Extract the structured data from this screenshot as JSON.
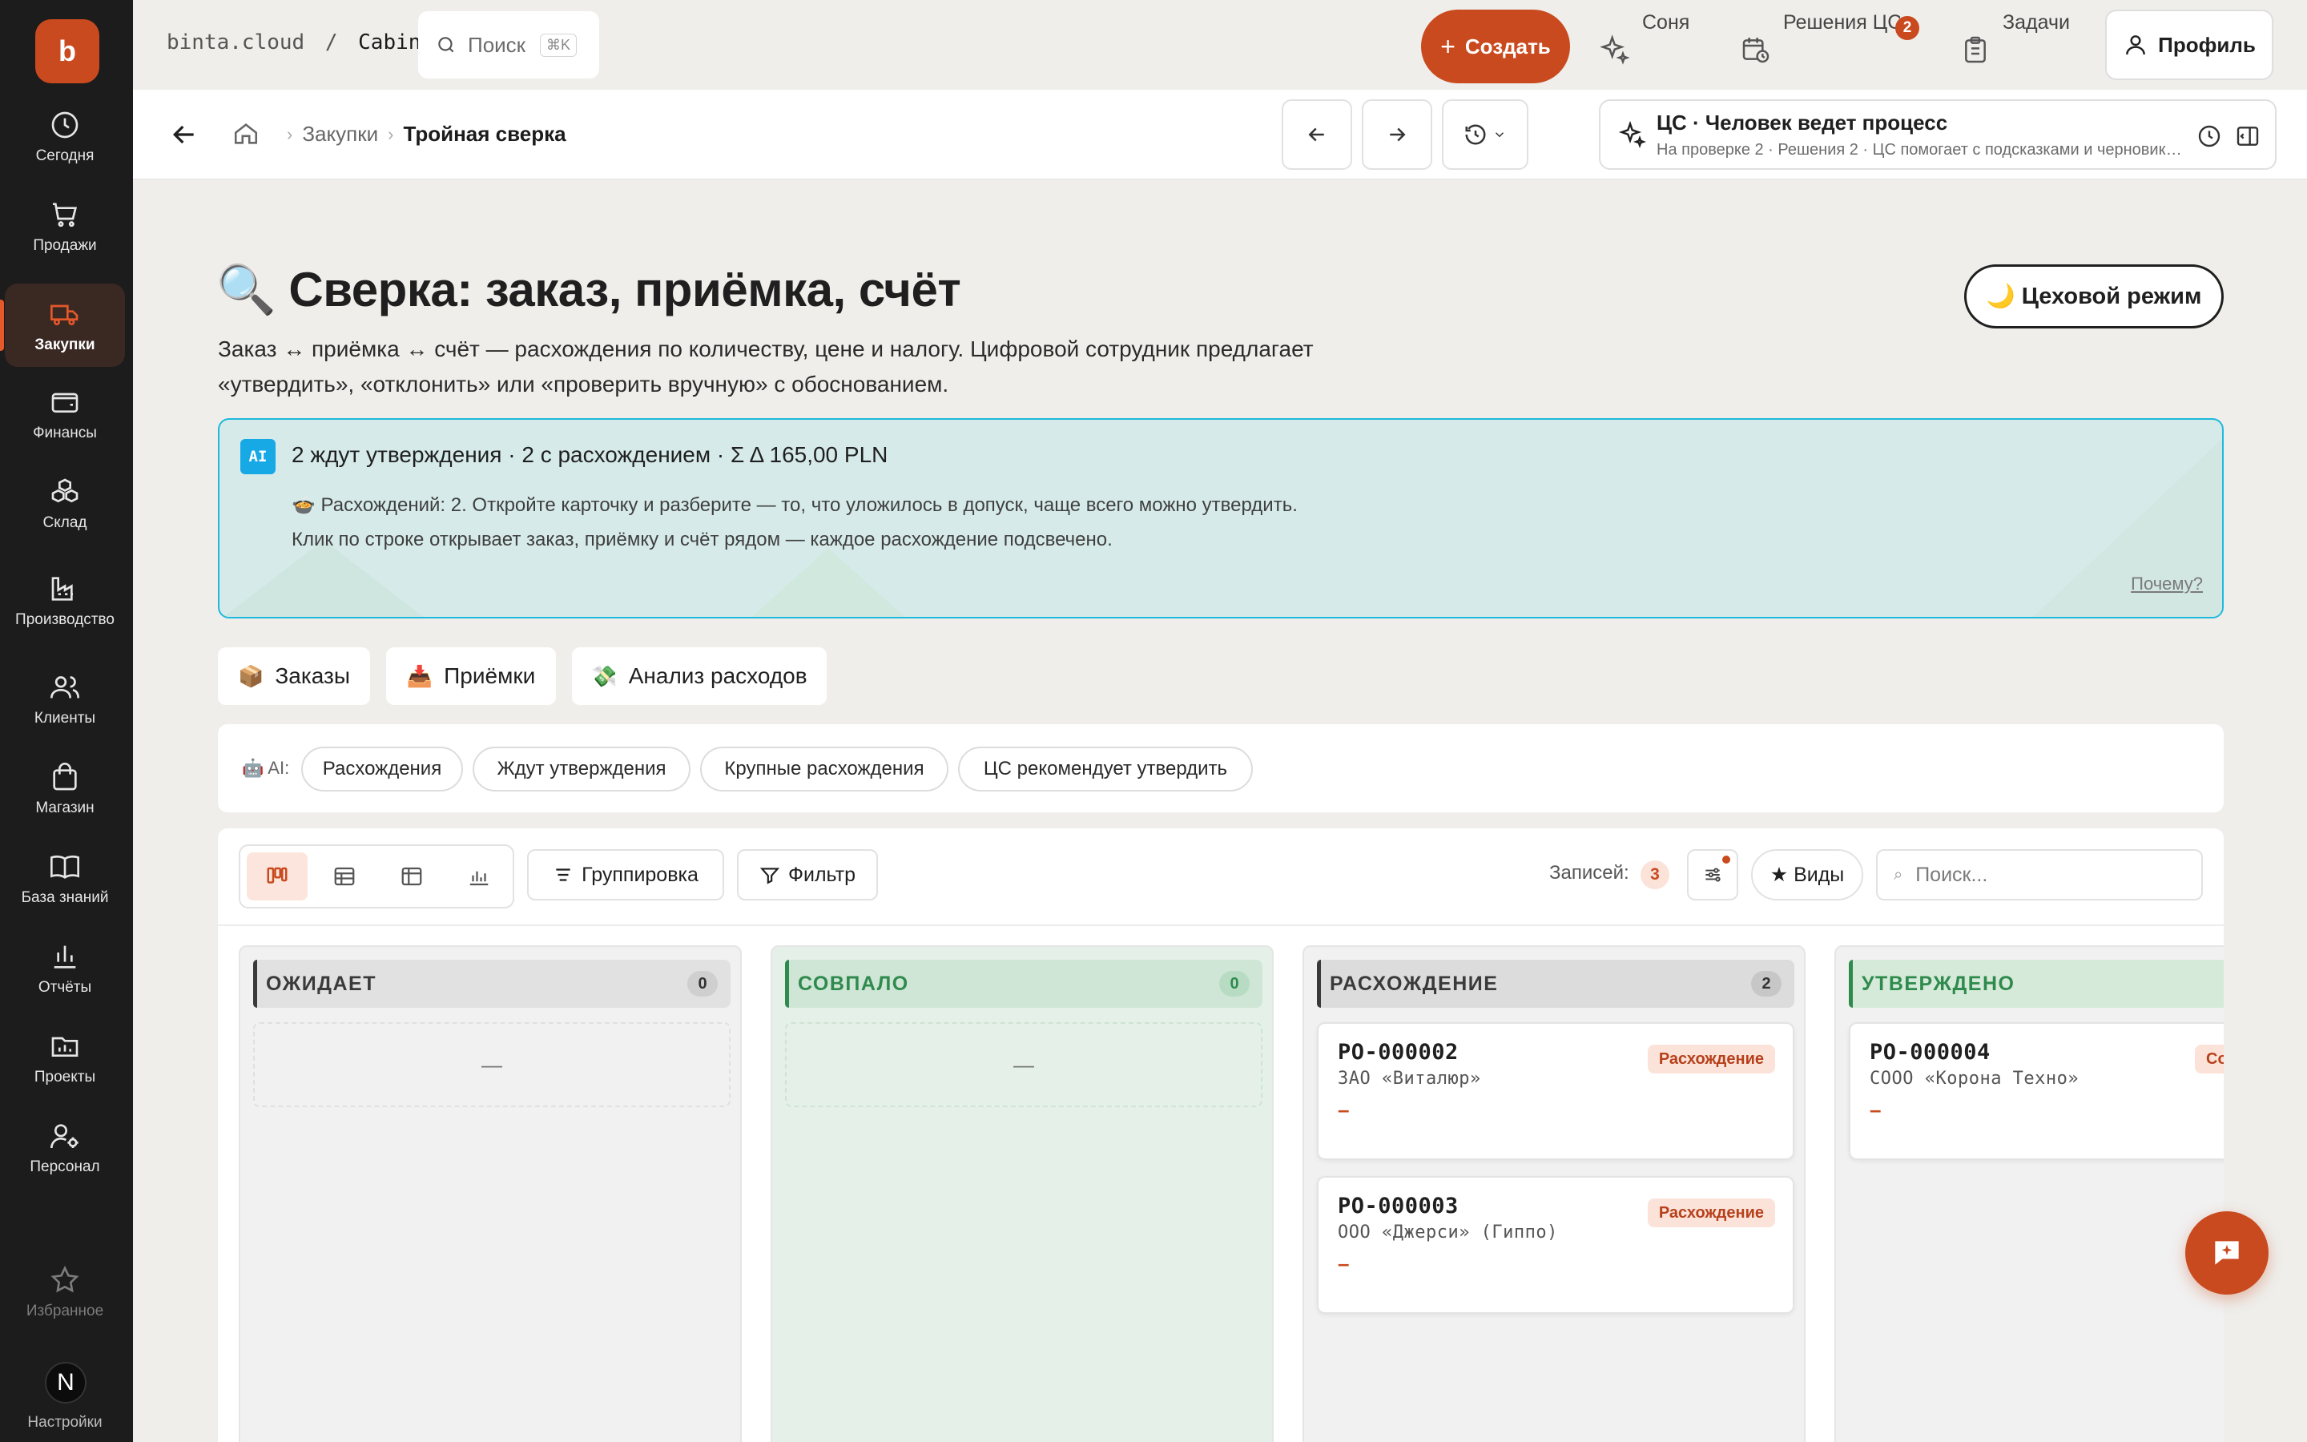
{
  "sidebar": {
    "logo": "b",
    "items": [
      {
        "label": "Сегодня",
        "icon": "clock-icon"
      },
      {
        "label": "Продажи",
        "icon": "cart-icon"
      },
      {
        "label": "Закупки",
        "icon": "truck-icon",
        "active": true
      },
      {
        "label": "Финансы",
        "icon": "wallet-icon"
      },
      {
        "label": "Склад",
        "icon": "boxes-icon"
      },
      {
        "label": "Производство",
        "icon": "factory-icon"
      },
      {
        "label": "Клиенты",
        "icon": "users-icon"
      },
      {
        "label": "Магазин",
        "icon": "bag-icon"
      },
      {
        "label": "База знаний",
        "icon": "book-icon"
      },
      {
        "label": "Отчёты",
        "icon": "chart-icon"
      },
      {
        "label": "Проекты",
        "icon": "folder-icon"
      },
      {
        "label": "Персонал",
        "icon": "user-gear-icon"
      }
    ],
    "favorites": "Избранное",
    "settings": "Настройки",
    "avatar_letter": "N"
  },
  "topbar": {
    "domain": "binta.cloud",
    "separator": "/",
    "workspace": "Cabinet",
    "search_placeholder": "Поиск",
    "search_shortcut": "⌘K",
    "create_label": "Создать",
    "agent_name": "Соня",
    "decisions_label": "Решения ЦС",
    "decisions_count": "2",
    "tasks_label": "Задачи",
    "profile_label": "Профиль"
  },
  "subheader": {
    "breadcrumb": [
      "Закупки",
      "Тройная сверка"
    ],
    "agent_title": "ЦС · Человек ведет процесс",
    "agent_subtitle": "На проверке 2 · Решения 2 · ЦС помогает с подсказками и черновиками"
  },
  "page": {
    "title": "🔍 Сверка: заказ, приёмка, счёт",
    "description": "Заказ ↔ приёмка ↔ счёт — расхождения по количеству, цене и налогу. Цифровой сотрудник предлагает «утвердить», «отклонить» или «проверить вручную» с обоснованием.",
    "shop_mode_label": "🌙 Цеховой режим"
  },
  "ai_banner": {
    "chip": "AI",
    "headline": "2 ждут утверждения · 2 с расхождением · Σ Δ 165,00 PLN",
    "line1": "🍲 Расхождений: 2. Откройте карточку и разберите — то, что уложилось в допуск, чаще всего можно утвердить.",
    "line2": "Клик по строке открывает заказ, приёмку и счёт рядом — каждое расхождение подсвечено.",
    "why_link": "Почему?"
  },
  "tabs": [
    {
      "emoji": "📦",
      "label": "Заказы"
    },
    {
      "emoji": "📥",
      "label": "Приёмки"
    },
    {
      "emoji": "💸",
      "label": "Анализ расходов"
    }
  ],
  "ai_filters": {
    "label": "🤖 AI:",
    "chips": [
      "Расхождения",
      "Ждут утверждения",
      "Крупные расхождения",
      "ЦС рекомендует утвердить"
    ]
  },
  "board_toolbar": {
    "group_label": "Группировка",
    "filter_label": "Фильтр",
    "records_label": "Записей:",
    "records_count": "3",
    "views_label": "★ Виды",
    "search_placeholder": "Поиск..."
  },
  "columns": [
    {
      "title": "ОЖИДАЕТ",
      "count": "0",
      "empty": "—",
      "accent": "#3a3a3a",
      "bg": "#e8e8e8"
    },
    {
      "title": "СОВПАЛО",
      "count": "0",
      "empty": "—",
      "accent": "#2f8a4d",
      "bg": "#dbece0"
    },
    {
      "title": "РАСХОЖДЕНИЕ",
      "count": "2",
      "accent": "#3a3a3a",
      "bg": "#e6e6e6",
      "cards": [
        {
          "id": "PO-000002",
          "company": "ЗАО «Виталюр»",
          "tag": "Расхождение",
          "value": "–"
        },
        {
          "id": "PO-000003",
          "company": "ООО «Джерси» (Гиппо)",
          "tag": "Расхождение",
          "value": "–"
        }
      ]
    },
    {
      "title": "УТВЕРЖДЕНО",
      "count": "",
      "accent": "#2f8a4d",
      "bg": "#dbece0",
      "cards": [
        {
          "id": "PO-000004",
          "company": "СООО «Корона Техно»",
          "tag": "Совпало",
          "value": "–"
        }
      ]
    }
  ]
}
